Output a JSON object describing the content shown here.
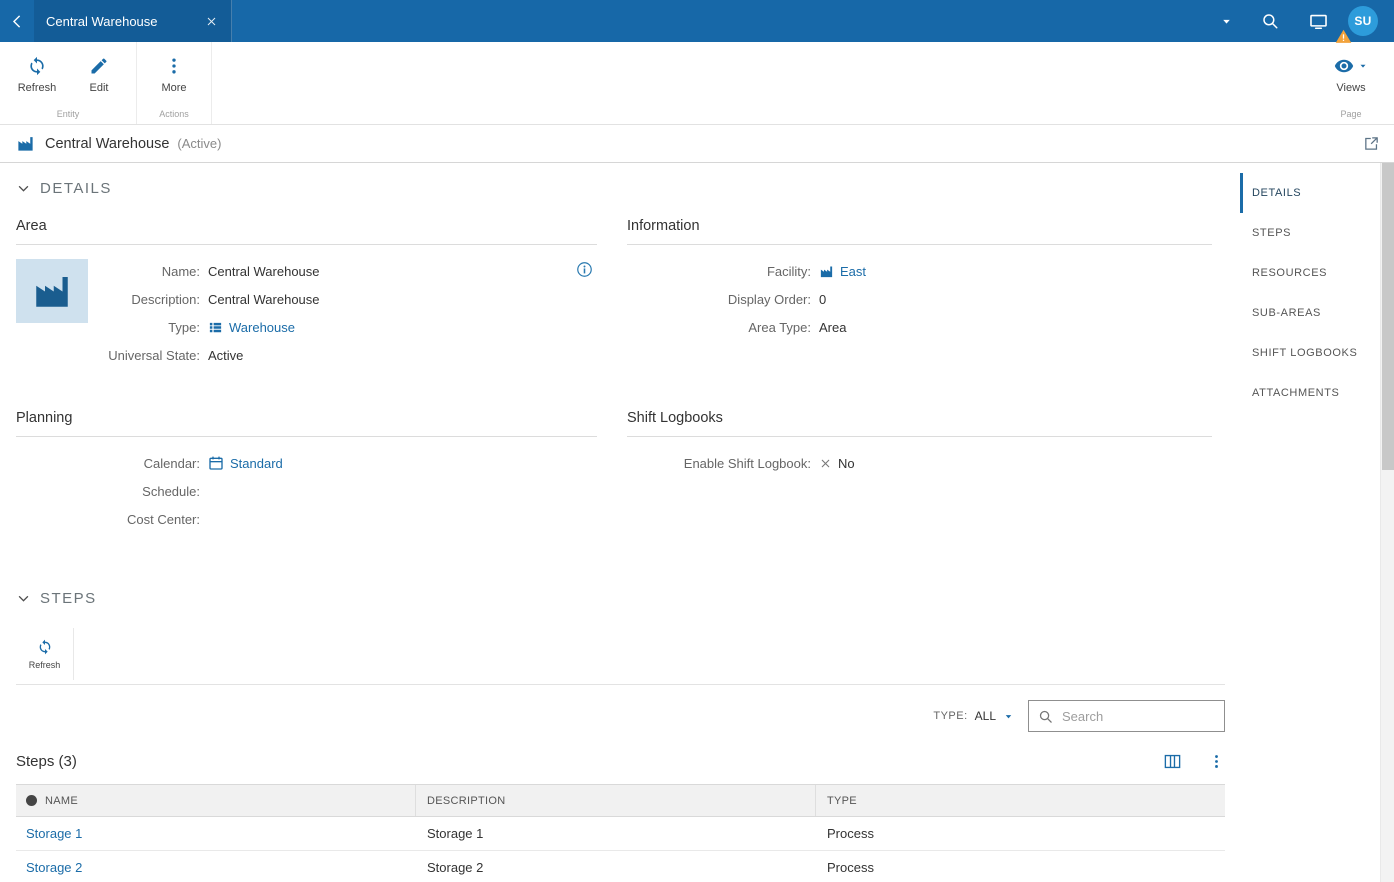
{
  "topbar": {
    "tab_title": "Central Warehouse",
    "avatar_initials": "SU"
  },
  "toolbar": {
    "refresh_label": "Refresh",
    "edit_label": "Edit",
    "more_label": "More",
    "entity_group_label": "Entity",
    "actions_group_label": "Actions",
    "views_label": "Views",
    "page_group_label": "Page"
  },
  "titlebar": {
    "title": "Central Warehouse",
    "state": "(Active)"
  },
  "details": {
    "section_title": "DETAILS",
    "area": {
      "title": "Area",
      "name_label": "Name:",
      "name_value": "Central Warehouse",
      "description_label": "Description:",
      "description_value": "Central Warehouse",
      "type_label": "Type:",
      "type_value": "Warehouse",
      "universal_state_label": "Universal State:",
      "universal_state_value": "Active"
    },
    "information": {
      "title": "Information",
      "facility_label": "Facility:",
      "facility_value": "East",
      "display_order_label": "Display Order:",
      "display_order_value": "0",
      "area_type_label": "Area Type:",
      "area_type_value": "Area"
    },
    "planning": {
      "title": "Planning",
      "calendar_label": "Calendar:",
      "calendar_value": "Standard",
      "schedule_label": "Schedule:",
      "schedule_value": "",
      "cost_center_label": "Cost Center:",
      "cost_center_value": ""
    },
    "shift_logbooks": {
      "title": "Shift Logbooks",
      "enable_label": "Enable Shift Logbook:",
      "enable_value": "No"
    }
  },
  "steps": {
    "section_title": "STEPS",
    "refresh_label": "Refresh",
    "type_filter_label": "TYPE:",
    "type_filter_value": "ALL",
    "search_placeholder": "Search",
    "table_title": "Steps (3)",
    "columns": {
      "name": "NAME",
      "description": "DESCRIPTION",
      "type": "TYPE"
    },
    "rows": [
      {
        "name": "Storage 1",
        "description": "Storage 1",
        "type": "Process"
      },
      {
        "name": "Storage 2",
        "description": "Storage 2",
        "type": "Process"
      }
    ]
  },
  "sidebar": {
    "items": [
      {
        "label": "DETAILS"
      },
      {
        "label": "STEPS"
      },
      {
        "label": "RESOURCES"
      },
      {
        "label": "SUB-AREAS"
      },
      {
        "label": "SHIFT LOGBOOKS"
      },
      {
        "label": "ATTACHMENTS"
      }
    ]
  },
  "colors": {
    "topbar_blue": "#1768a8",
    "accent_blue": "#1b6ca8",
    "avatar_blue": "#2d9cdb",
    "warning_orange": "#f2a33c"
  }
}
